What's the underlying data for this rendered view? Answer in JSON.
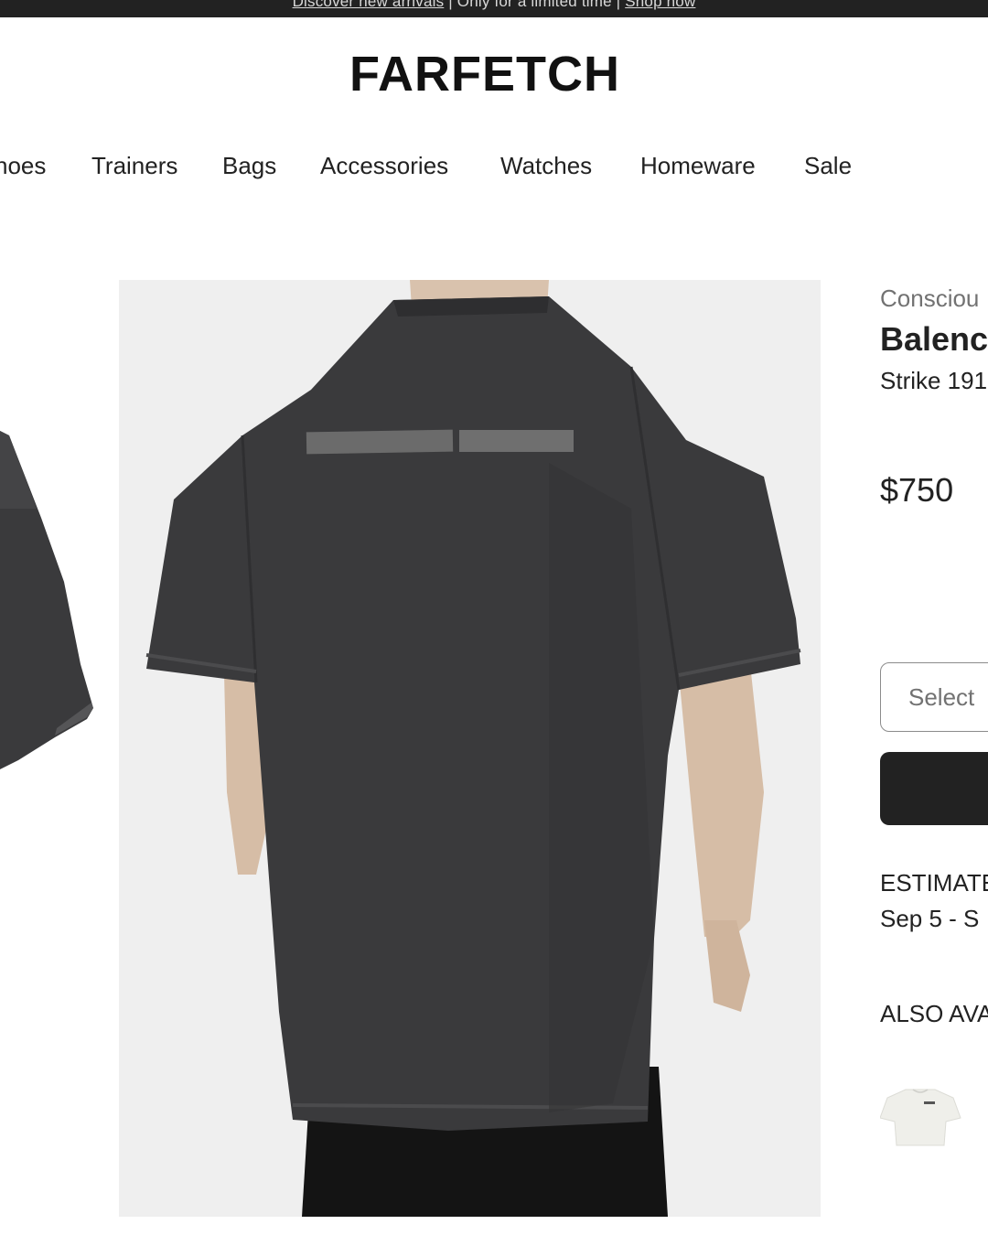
{
  "promo": {
    "text_left": "Discover new arrivals",
    "text_mid": " | Only for a limited time | ",
    "text_right": "Shop now"
  },
  "header": {
    "logo": "FARFETCH"
  },
  "nav": {
    "items": [
      {
        "label": "hoes"
      },
      {
        "label": "Trainers"
      },
      {
        "label": "Bags"
      },
      {
        "label": "Accessories"
      },
      {
        "label": "Watches"
      },
      {
        "label": "Homeware"
      },
      {
        "label": "Sale"
      }
    ]
  },
  "product": {
    "label": "Consciou",
    "brand": "Balenc",
    "name": "Strike 191",
    "price": "$750",
    "size_placeholder": "Select",
    "delivery_title": "ESTIMATE",
    "delivery_dates": "Sep 5 - S",
    "also_available_title": "ALSO AVA"
  },
  "colors": {
    "banner": "#222222",
    "text": "#222222",
    "muted": "#727272",
    "image_bg": "#efefef",
    "shirt": "#3a3a3c",
    "button": "#222222"
  },
  "icons": {
    "product_image": "black-oversized-tshirt-back-photo",
    "side_thumbnail": "black-tshirt-front-photo",
    "also_thumb": "white-tshirt-photo"
  }
}
